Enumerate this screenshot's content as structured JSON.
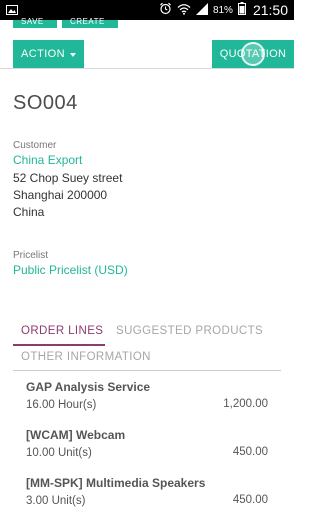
{
  "status_bar": {
    "battery": "81%",
    "time": "21:50",
    "icons": [
      "image-icon",
      "alarm-icon",
      "wifi-icon",
      "signal-icon",
      "battery-icon"
    ]
  },
  "top_buttons": [
    "SAVE",
    "CREATE"
  ],
  "action_bar": {
    "action_label": "ACTION",
    "state_label": "QUOTATION"
  },
  "order": {
    "reference": "SO004",
    "customer_label": "Customer",
    "customer_name": "China Export",
    "address": [
      "52 Chop Suey street",
      "Shanghai 200000",
      "China"
    ],
    "pricelist_label": "Pricelist",
    "pricelist": "Public Pricelist (USD)"
  },
  "tabs": {
    "order_lines": "ORDER LINES",
    "suggested_products": "SUGGESTED PRODUCTS",
    "other_information": "OTHER INFORMATION",
    "active": "order_lines"
  },
  "order_lines": [
    {
      "product": "GAP Analysis Service",
      "quantity": "16.00 Hour(s)",
      "amount": "1,200.00"
    },
    {
      "product": "[WCAM] Webcam",
      "quantity": "10.00 Unit(s)",
      "amount": "450.00"
    },
    {
      "product": "[MM-SPK] Multimedia Speakers",
      "quantity": "3.00 Unit(s)",
      "amount": "450.00"
    }
  ],
  "colors": {
    "accent": "#21b799",
    "active_tab": "#8c3b6e"
  }
}
